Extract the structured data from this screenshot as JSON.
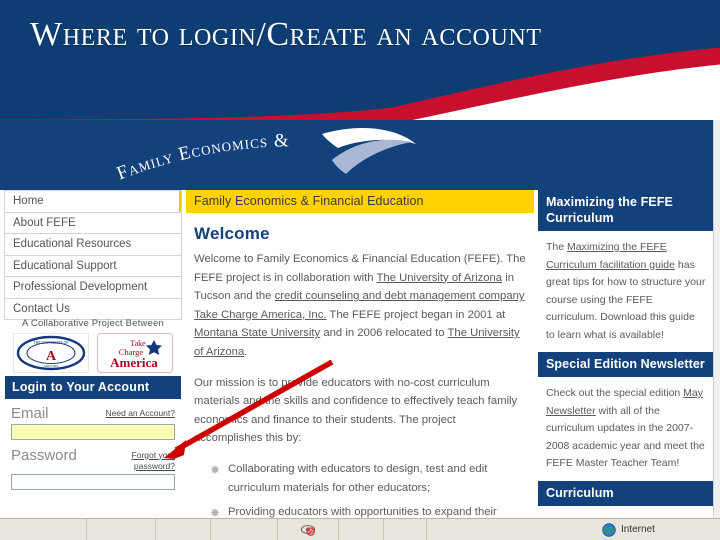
{
  "slide": {
    "title": "Where to login/Create an account",
    "title_bg_color": "#0d3d73",
    "accent_red": "#c8102e"
  },
  "site": {
    "logo_text": "Family Economics &",
    "header_bg_color": "#13417c",
    "banner_title": "Family Economics & Financial Education",
    "banner_bg_color": "#ffd200"
  },
  "nav": {
    "items": [
      {
        "label": "Home",
        "active": true
      },
      {
        "label": "About FEFE",
        "active": false
      },
      {
        "label": "Educational Resources",
        "active": false
      },
      {
        "label": "Educational Support",
        "active": false
      },
      {
        "label": "Professional Development",
        "active": false
      },
      {
        "label": "Contact Us",
        "active": false
      }
    ]
  },
  "collaborators": {
    "label": "A Collaborative Project Between",
    "logo1_line1": "THE UNIVERSITY OF",
    "logo1_letter": "A",
    "logo1_line2": "ARIZONA",
    "logo2_line1": "Take",
    "logo2_line2": "Charge",
    "logo2_line3": "America"
  },
  "login": {
    "header": "Login to Your Account",
    "email_label": "Email",
    "email_value": "",
    "need_account_link": "Need an Account?",
    "password_label": "Password",
    "password_value": "",
    "forgot_link": "Forgot your password?"
  },
  "main": {
    "heading": "Welcome",
    "para1_a": "Welcome to Family Economics & Financial Education (FEFE). The FEFE project is in collaboration with ",
    "para1_link1": "The University of Arizona",
    "para1_b": " in Tucson and the ",
    "para1_link2": "credit counseling and debt management company Take Charge America, Inc.",
    "para1_c": " The FEFE project began in 2001 at ",
    "para1_link3": "Montana State University",
    "para1_d": " and in 2006 relocated to ",
    "para1_link4": "The University of Arizona",
    "para1_e": ".",
    "para2": "Our mission is to provide educators with no-cost curriculum materials and the skills and confidence to effectively teach family economics and finance to their students. The project accomplishes this by:",
    "bullets": [
      "Collaborating with educators to design, test and edit curriculum materials for other educators;",
      "Providing educators with opportunities to expand their"
    ]
  },
  "panels": [
    {
      "title": "Maximizing the FEFE Curriculum",
      "body_a": "The ",
      "body_link": "Maximizing the FEFE Curriculum facilitation guide",
      "body_b": " has great tips for how to structure your course using the FEFE curriculum.  Download this guide to learn what is available!"
    },
    {
      "title": "Special Edition Newsletter",
      "body_a": "Check out the special edition ",
      "body_link": "May Newsletter",
      "body_b": " with all of the curriculum updates in the 2007-2008 academic year and meet the FEFE Master Teacher Team!"
    },
    {
      "title": "Curriculum",
      "body_a": "",
      "body_link": "",
      "body_b": ""
    }
  ],
  "statusbar": {
    "privacy_icon": "privacy-eye-icon",
    "zone_icon": "globe-icon",
    "zone_label": "Internet"
  }
}
